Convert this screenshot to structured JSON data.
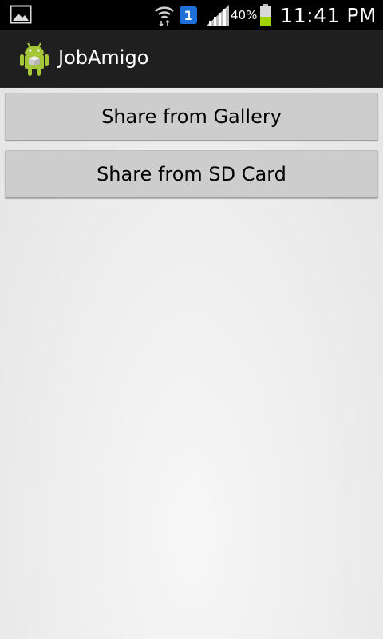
{
  "status_bar": {
    "notification_icon": "image-icon",
    "wifi_icon": "wifi-icon",
    "sim_badge": "1",
    "signal_icon": "signal-icon",
    "battery_percent": "40%",
    "battery_icon": "battery-icon",
    "time": "11:41 PM"
  },
  "action_bar": {
    "app_icon": "android-icon",
    "title": "JobAmigo"
  },
  "buttons": {
    "gallery_label": "Share from Gallery",
    "sd_card_label": "Share from SD Card"
  },
  "colors": {
    "action_bar_bg": "#1f1f1f",
    "button_bg": "#cdcdcd",
    "battery_fill": "#9fd400",
    "android_green": "#a4c639"
  }
}
